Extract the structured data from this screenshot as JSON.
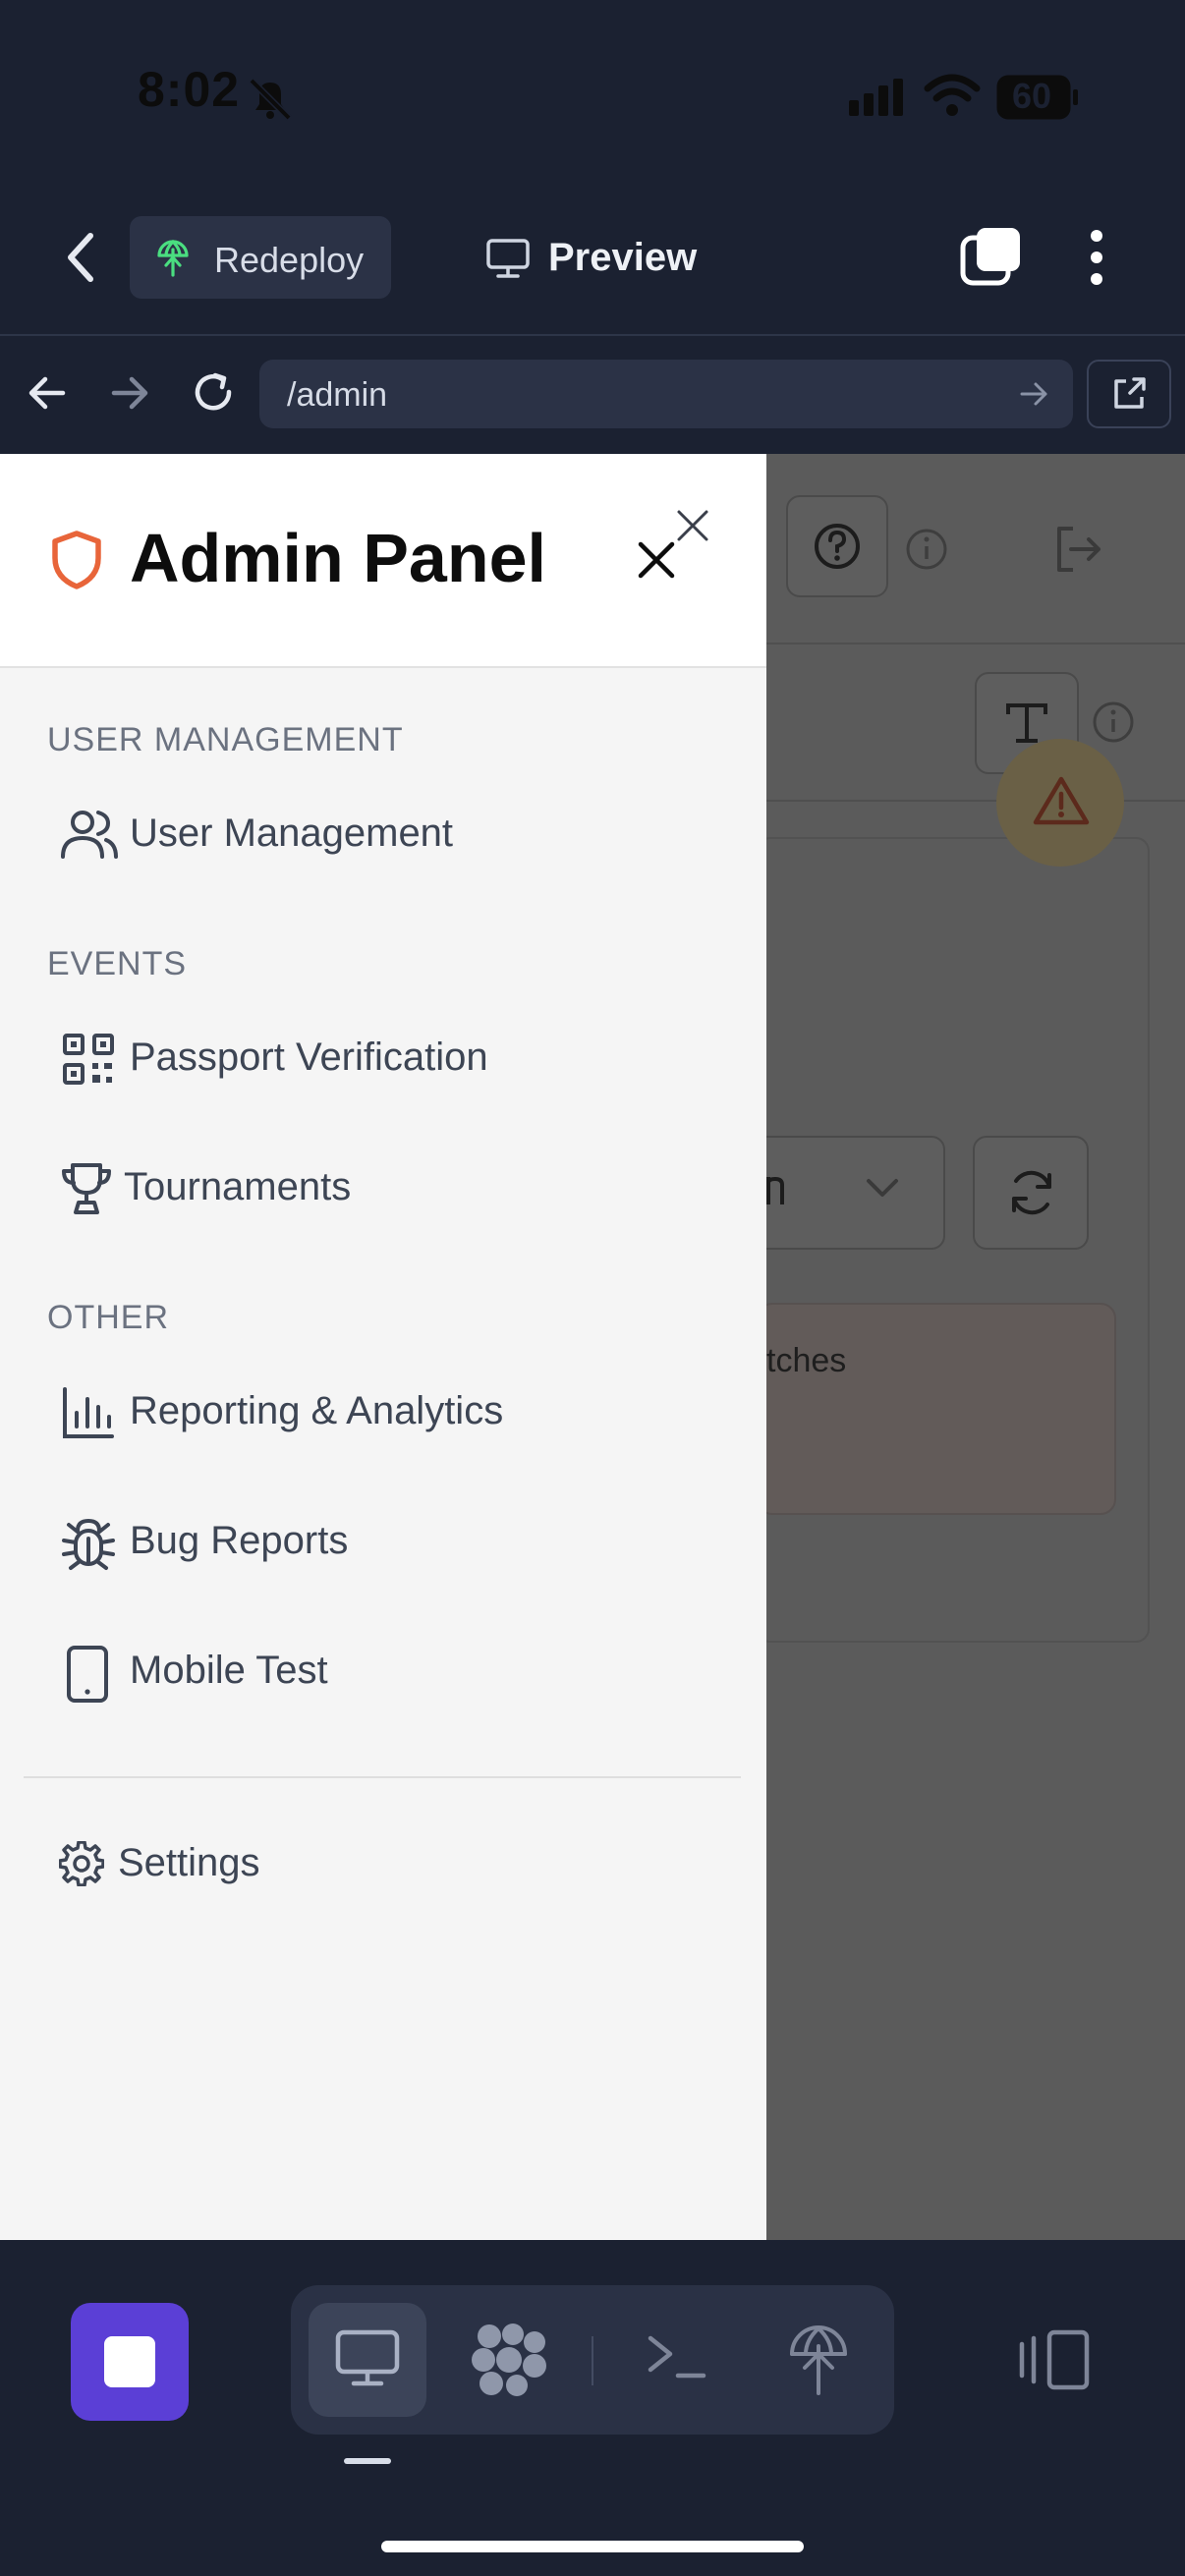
{
  "status_bar": {
    "time": "8:02",
    "battery": "60"
  },
  "top_bar": {
    "back_icon": "chevron-left-icon",
    "redeploy_label": "Redeploy",
    "preview_label": "Preview"
  },
  "url_bar": {
    "url": "/admin"
  },
  "drawer": {
    "title": "Admin Panel",
    "sections": [
      {
        "label": "USER MANAGEMENT",
        "items": [
          {
            "label": "User Management",
            "icon": "users-icon"
          }
        ]
      },
      {
        "label": "EVENTS",
        "items": [
          {
            "label": "Passport Verification",
            "icon": "qr-code-icon"
          },
          {
            "label": "Tournaments",
            "icon": "trophy-icon"
          }
        ]
      },
      {
        "label": "OTHER",
        "items": [
          {
            "label": "Reporting & Analytics",
            "icon": "bar-chart-icon"
          },
          {
            "label": "Bug Reports",
            "icon": "bug-icon"
          },
          {
            "label": "Mobile Test",
            "icon": "smartphone-icon"
          }
        ]
      }
    ],
    "settings_label": "Settings"
  },
  "background_page": {
    "visible_text": "tches"
  },
  "colors": {
    "accent_orange": "#e8653a",
    "stop_button": "#5b3fd6",
    "app_bg": "#1b2131"
  }
}
